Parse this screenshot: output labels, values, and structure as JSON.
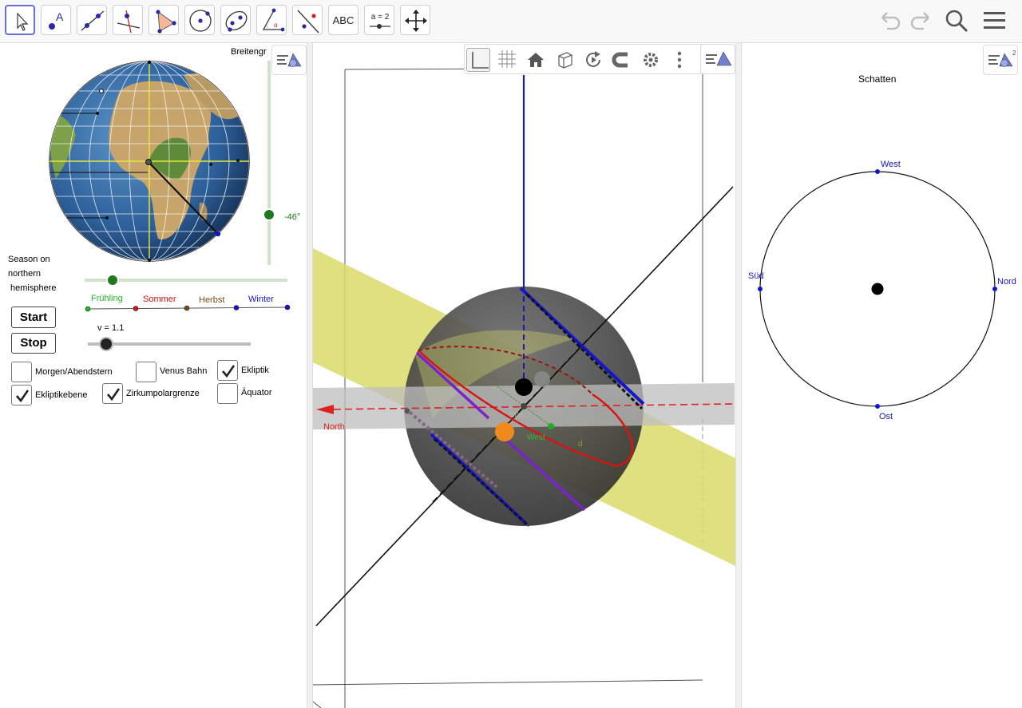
{
  "toolbar": {
    "tools": [
      {
        "name": "move-tool",
        "icon": "arrow-pointer-icon"
      },
      {
        "name": "point-tool",
        "icon": "point-icon",
        "label": "A"
      },
      {
        "name": "line-tool",
        "icon": "line-icon"
      },
      {
        "name": "perpendicular-tool",
        "icon": "perpendicular-line-icon"
      },
      {
        "name": "polygon-tool",
        "icon": "polygon-icon"
      },
      {
        "name": "circle-tool",
        "icon": "circle-center-point-icon"
      },
      {
        "name": "ellipse-tool",
        "icon": "ellipse-icon"
      },
      {
        "name": "angle-tool",
        "icon": "angle-icon"
      },
      {
        "name": "reflect-tool",
        "icon": "reflect-line-icon"
      },
      {
        "name": "text-tool",
        "icon": "text-icon",
        "label": "ABC"
      },
      {
        "name": "slider-tool",
        "icon": "slider-icon",
        "label": "a = 2"
      },
      {
        "name": "move-view-tool",
        "icon": "move-graphics-icon"
      }
    ],
    "right": [
      "undo-icon",
      "redo-icon",
      "search-icon",
      "menu-icon"
    ]
  },
  "left_panel": {
    "latitude_label": "Breitengr",
    "latitude_value": "-46°",
    "season_label_1": "Season on",
    "season_label_2": "northern",
    "season_label_3": "hemisphere",
    "seasons": [
      {
        "label": "Frühling",
        "color": "#22bb22"
      },
      {
        "label": "Sommer",
        "color": "#dd1111"
      },
      {
        "label": "Herbst",
        "color": "#7a4a1a"
      },
      {
        "label": "Winter",
        "color": "#1515cc"
      }
    ],
    "start_label": "Start",
    "stop_label": "Stop",
    "speed_label": "v = 1.1",
    "checkboxes": [
      {
        "label": "Morgen/Abendstern",
        "checked": false
      },
      {
        "label": "Venus Bahn",
        "checked": false
      },
      {
        "label": "Ekliptik",
        "checked": true
      },
      {
        "label": "Ekliptikebene",
        "checked": true
      },
      {
        "label": "Zirkumpolargrenze",
        "checked": true
      },
      {
        "label": "Äquator",
        "checked": false
      }
    ]
  },
  "view3d": {
    "graphics_bar": [
      "axes-icon",
      "grid-icon",
      "home-icon",
      "view-cube-icon",
      "rotate-view-icon",
      "magnet-icon",
      "gear-icon",
      "more-vertical-icon"
    ],
    "style_bar_icon": "style-bar-toggle-icon",
    "north_label": "North",
    "sun_label": "Sun",
    "west_label": "West",
    "d_label": "d",
    "colors": {
      "plane_yellow": "#d9dc6a",
      "horizon_gray": "#bdbdbd",
      "sphere": "#3a3a3a",
      "axis_blue": "#1a1aaa",
      "north_red": "#dd2222"
    }
  },
  "right_panel": {
    "title": "Schatten",
    "west": "West",
    "sued": "Süd",
    "nord": "Nord",
    "ost": "Ost",
    "style_bar_icon": "style-bar-toggle-icon"
  }
}
